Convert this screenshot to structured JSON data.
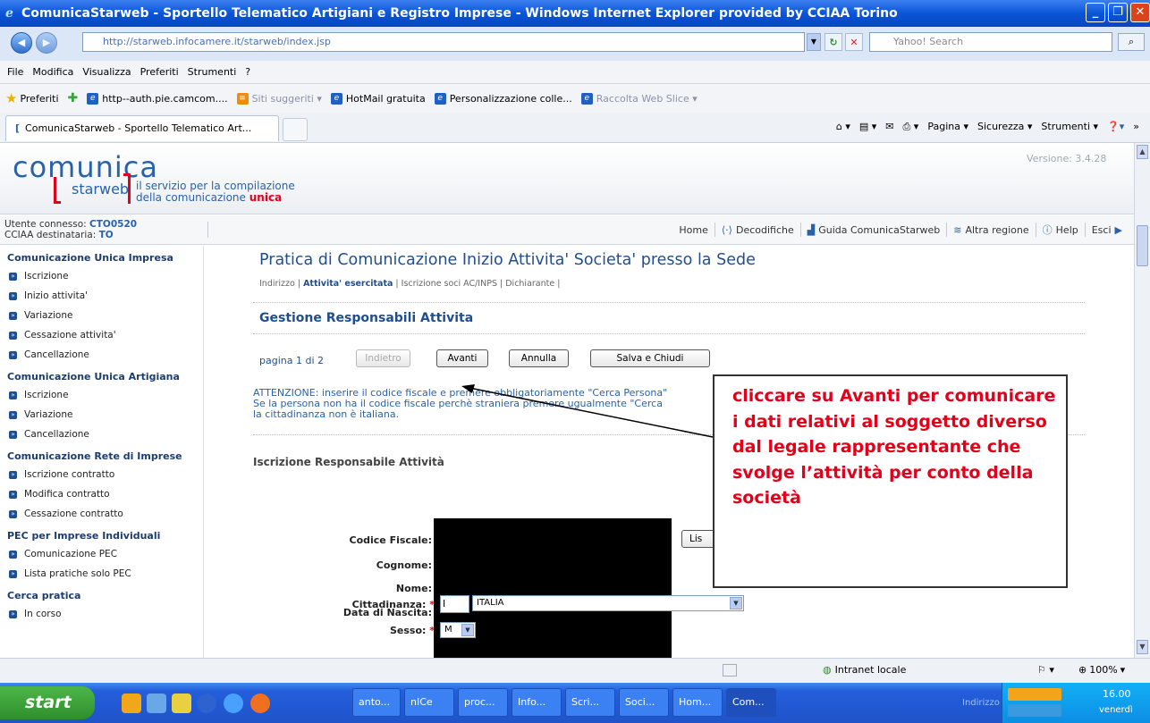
{
  "window": {
    "title": "ComunicaStarweb - Sportello Telematico Artigiani e Registro Imprese - Windows Internet Explorer provided by CCIAA Torino"
  },
  "address": {
    "url": "http://starweb.infocamere.it/starweb/index.jsp",
    "search_placeholder": "Yahoo! Search"
  },
  "menu": [
    "File",
    "Modifica",
    "Visualizza",
    "Preferiti",
    "Strumenti",
    "?"
  ],
  "favorites": {
    "label": "Preferiti",
    "items": [
      "http--auth.pie.camcom....",
      "Siti suggeriti ▾",
      "HotMail gratuita",
      "Personalizzazione colle...",
      "Raccolta Web Slice ▾"
    ]
  },
  "tab": {
    "label": "ComunicaStarweb - Sportello Telematico Art..."
  },
  "commands": [
    "Pagina ▾",
    "Sicurezza ▾",
    "Strumenti ▾"
  ],
  "app": {
    "logo_top": "comunica",
    "logo_bottom": "starweb",
    "tagline_1": "il servizio per la compilazione",
    "tagline_2": "della comunicazione",
    "tagline_3": "unica",
    "version": "Versione: 3.4.28",
    "user_label": "Utente connesso:",
    "user": "CTO0520",
    "cciaa_label": "CCIAA destinataria:",
    "cciaa": "TO"
  },
  "topnav": [
    "Home",
    "Decodifiche",
    "Guida ComunicaStarweb",
    "Altra regione",
    "Help",
    "Esci"
  ],
  "sidebar": [
    {
      "title": "Comunicazione Unica Impresa",
      "items": [
        "Iscrizione",
        "Inizio attivita'",
        "Variazione",
        "Cessazione attivita'",
        "Cancellazione"
      ]
    },
    {
      "title": "Comunicazione Unica Artigiana",
      "items": [
        "Iscrizione",
        "Variazione",
        "Cancellazione"
      ]
    },
    {
      "title": "Comunicazione Rete di Imprese",
      "items": [
        "Iscrizione contratto",
        "Modifica contratto",
        "Cessazione contratto"
      ]
    },
    {
      "title": "PEC per Imprese Individuali",
      "items": [
        "Comunicazione PEC",
        "Lista pratiche solo PEC"
      ]
    },
    {
      "title": "Cerca pratica",
      "items": [
        "In corso"
      ]
    }
  ],
  "main": {
    "title": "Pratica di Comunicazione Inizio Attivita' Societa' presso la Sede",
    "crumbs": {
      "c1": "Indirizzo",
      "c2": "Attivita' esercitata",
      "c3": "Iscrizione soci AC/INPS",
      "c4": "Dichiarante"
    },
    "section_title": "Gestione Responsabili Attivita",
    "pagina": "pagina 1 di 2",
    "buttons": {
      "indietro": "Indietro",
      "avanti": "Avanti",
      "annulla": "Annulla",
      "salva": "Salva e Chiudi"
    },
    "warning_1": "ATTENZIONE: inserire il codice fiscale e premere obbligatoriamente \"Cerca Persona\"",
    "warning_2": "Se la persona non ha il codice fiscale perchè straniera premere ugualmente \"Cerca",
    "warning_3": "la cittadinanza non è italiana.",
    "resp_title": "Iscrizione Responsabile Attività",
    "labels": {
      "cf": "Codice Fiscale:",
      "cognome": "Cognome:",
      "nome": "Nome:",
      "nascita": "Data di Nascita:",
      "citt": "Cittadinanza:",
      "sesso": "Sesso:"
    },
    "lis_label": "Lis",
    "citt_code": "I",
    "citt_value": "ITALIA",
    "sesso_value": "M"
  },
  "callout": "cliccare su Avanti per comunicare i dati relativi al soggetto diverso dal legale rappresentante che svolge l’attività per conto della società",
  "statusbar": {
    "zone": "Intranet locale",
    "zoom": "100%"
  },
  "taskbar": {
    "start": "start",
    "tasks": [
      "anto...",
      "nICe",
      "proc...",
      "Info...",
      "Scri...",
      "Soci...",
      "Hom...",
      "Com..."
    ],
    "indirizzo": "Indirizzo",
    "time": "16.00",
    "day": "venerdì"
  }
}
